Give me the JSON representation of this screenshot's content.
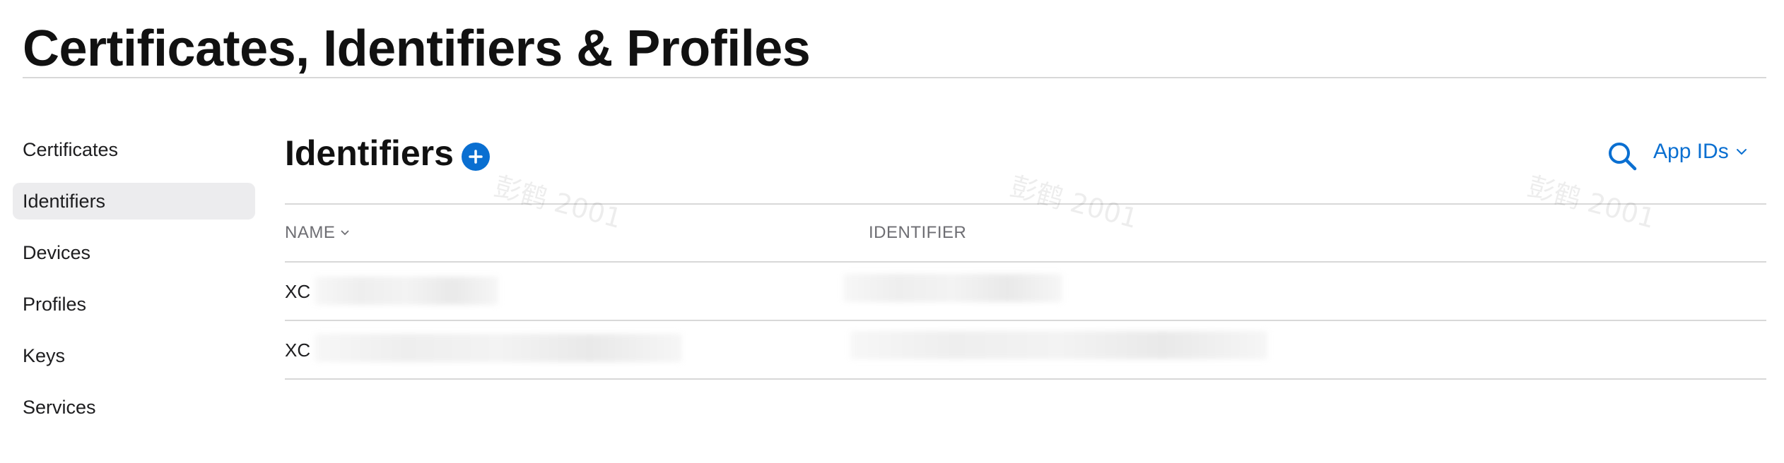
{
  "page": {
    "title": "Certificates, Identifiers & Profiles"
  },
  "sidebar": {
    "items": [
      {
        "label": "Certificates"
      },
      {
        "label": "Identifiers"
      },
      {
        "label": "Devices"
      },
      {
        "label": "Profiles"
      },
      {
        "label": "Keys"
      },
      {
        "label": "Services"
      }
    ],
    "active": "Identifiers"
  },
  "main": {
    "section_title": "Identifiers",
    "filter_label": "App IDs",
    "accent_color": "#0a6fd1",
    "table": {
      "headers": {
        "name": "NAME",
        "identifier": "IDENTIFIER"
      },
      "rows": [
        {
          "name": "XC",
          "identifier": ""
        },
        {
          "name": "XC",
          "identifier": ""
        }
      ]
    }
  },
  "watermark": {
    "text": "彭鹤 2001"
  }
}
